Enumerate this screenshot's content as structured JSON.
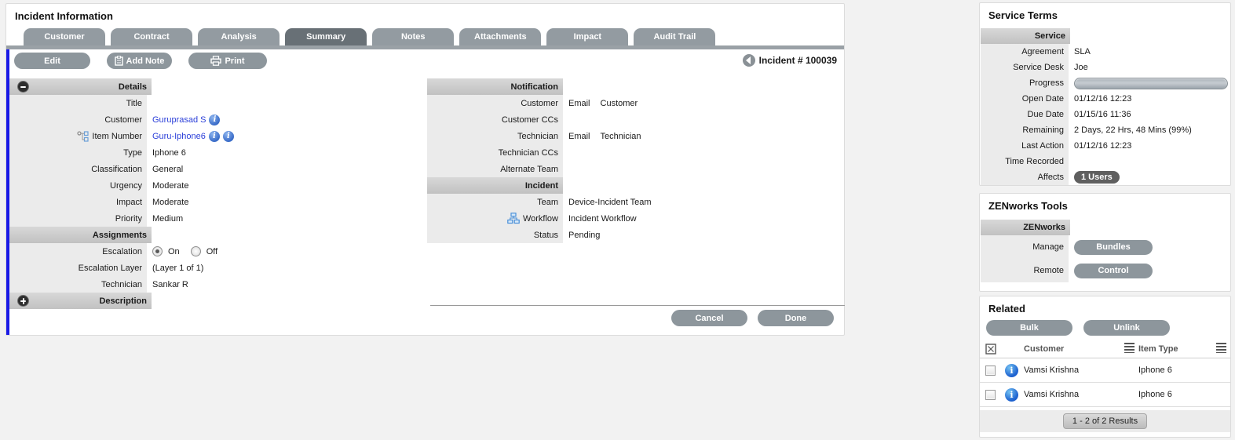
{
  "colors": {
    "link": "#2b3fd9",
    "left_border": "#1a1ae6",
    "tab_active": "#687076",
    "tab_inactive": "#939ba1"
  },
  "icons": {
    "collapse-icon": "dark circle minus",
    "expand-icon": "dark circle plus",
    "info-icon": "blue circle i",
    "back-icon": "gray circle left arrow",
    "hierarchy-icon": "item relationship tree",
    "workflow-icon": "blue org chart",
    "clipboard-icon": "white clipboard",
    "printer-icon": "white printer",
    "select-all-icon": "box with x",
    "sort-icon": "stacked lines"
  },
  "main": {
    "title": "Incident Information",
    "tabs": [
      {
        "label": "Customer"
      },
      {
        "label": "Contract"
      },
      {
        "label": "Analysis"
      },
      {
        "label": "Summary"
      },
      {
        "label": "Notes"
      },
      {
        "label": "Attachments"
      },
      {
        "label": "Impact"
      },
      {
        "label": "Audit Trail"
      }
    ],
    "toolbar": {
      "edit": "Edit",
      "add_note": "Add Note",
      "print": "Print"
    },
    "incident_ref": "Incident # 100039",
    "details": {
      "header": "Details",
      "rows": [
        {
          "label": "Title",
          "value": ""
        },
        {
          "label": "Customer",
          "value": "Guruprasad S"
        },
        {
          "label": "Item Number",
          "value": "Guru-Iphone6"
        },
        {
          "label": "Type",
          "value": "Iphone 6"
        },
        {
          "label": "Classification",
          "value": "General"
        },
        {
          "label": "Urgency",
          "value": "Moderate"
        },
        {
          "label": "Impact",
          "value": "Moderate"
        },
        {
          "label": "Priority",
          "value": "Medium"
        }
      ]
    },
    "assignments": {
      "header": "Assignments",
      "escalation": {
        "label": "Escalation",
        "on": "On",
        "off": "Off"
      },
      "rows": [
        {
          "label": "Escalation Layer",
          "value": "(Layer 1 of 1)"
        },
        {
          "label": "Technician",
          "value": "Sankar R"
        }
      ]
    },
    "description_header": "Description",
    "notification": {
      "header": "Notification",
      "rows": [
        {
          "label": "Customer",
          "value": "Email",
          "value2": "Customer"
        },
        {
          "label": "Customer CCs",
          "value": ""
        },
        {
          "label": "Technician",
          "value": "Email",
          "value2": "Technician"
        },
        {
          "label": "Technician CCs",
          "value": ""
        },
        {
          "label": "Alternate Team",
          "value": ""
        }
      ]
    },
    "incident": {
      "header": "Incident",
      "rows": [
        {
          "label": "Team",
          "value": "Device-Incident Team"
        },
        {
          "label": "Workflow",
          "value": "Incident Workflow"
        },
        {
          "label": "Status",
          "value": "Pending"
        }
      ]
    },
    "footer": {
      "cancel": "Cancel",
      "done": "Done"
    }
  },
  "service_terms": {
    "title": "Service Terms",
    "header": "Service",
    "rows": [
      {
        "label": "Agreement",
        "value": "SLA"
      },
      {
        "label": "Service Desk",
        "value": "Joe"
      },
      {
        "label": "Progress",
        "value": ""
      },
      {
        "label": "Open Date",
        "value": "01/12/16 12:23"
      },
      {
        "label": "Due Date",
        "value": "01/15/16 11:36"
      },
      {
        "label": "Remaining",
        "value": "2 Days, 22 Hrs, 48 Mins (99%)"
      },
      {
        "label": "Last Action",
        "value": "01/12/16 12:23"
      },
      {
        "label": "Time Recorded",
        "value": ""
      },
      {
        "label": "Affects",
        "value": "1 Users"
      }
    ]
  },
  "zenworks": {
    "title": "ZENworks Tools",
    "header": "ZENworks",
    "manage_label": "Manage",
    "manage_button": "Bundles",
    "remote_label": "Remote",
    "remote_button": "Control"
  },
  "related": {
    "title": "Related",
    "bulk_button": "Bulk",
    "unlink_button": "Unlink",
    "columns": {
      "customer": "Customer",
      "item_type": "Item Type"
    },
    "rows": [
      {
        "customer": "Vamsi Krishna",
        "item_type": "Iphone 6"
      },
      {
        "customer": "Vamsi Krishna",
        "item_type": "Iphone 6"
      }
    ],
    "pagination": "1 - 2 of 2 Results"
  }
}
